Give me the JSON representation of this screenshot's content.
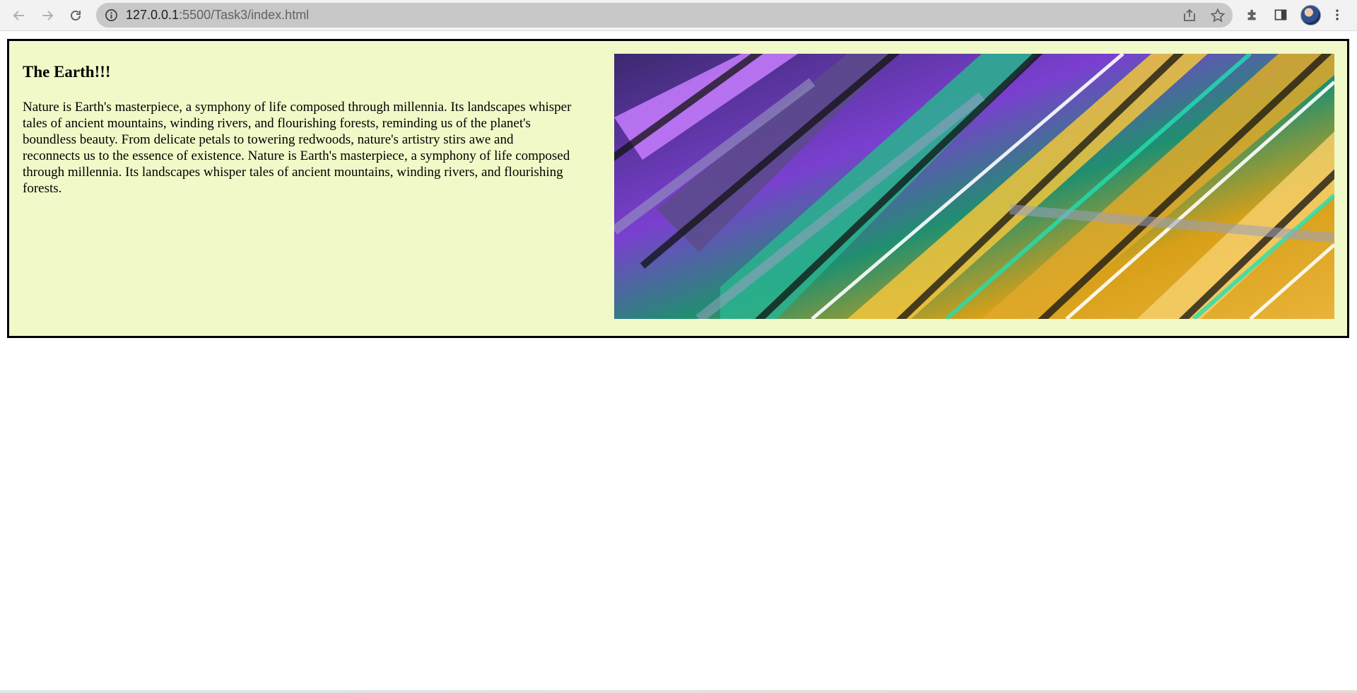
{
  "browser": {
    "url_host": "127.0.0.1",
    "url_path": ":5500/Task3/index.html",
    "icons": {
      "back": "arrow-left-icon",
      "forward": "arrow-right-icon",
      "reload": "reload-icon",
      "site_info": "info-icon",
      "share": "share-icon",
      "bookmark": "star-icon",
      "extensions": "puzzle-icon",
      "side_panel": "side-panel-icon",
      "menu": "kebab-menu-icon"
    }
  },
  "content": {
    "heading": "The Earth!!!",
    "paragraph": "Nature is Earth's masterpiece, a symphony of life composed through millennia. Its landscapes whisper tales of ancient mountains, winding rivers, and flourishing forests, reminding us of the planet's boundless beauty. From delicate petals to towering redwoods, nature's artistry stirs awe and reconnects us to the essence of existence. Nature is Earth's masterpiece, a symphony of life composed through millennia. Its landscapes whisper tales of ancient mountains, winding rivers, and flourishing forests.",
    "background_color": "#f1f9c8",
    "border_color": "#000000"
  }
}
